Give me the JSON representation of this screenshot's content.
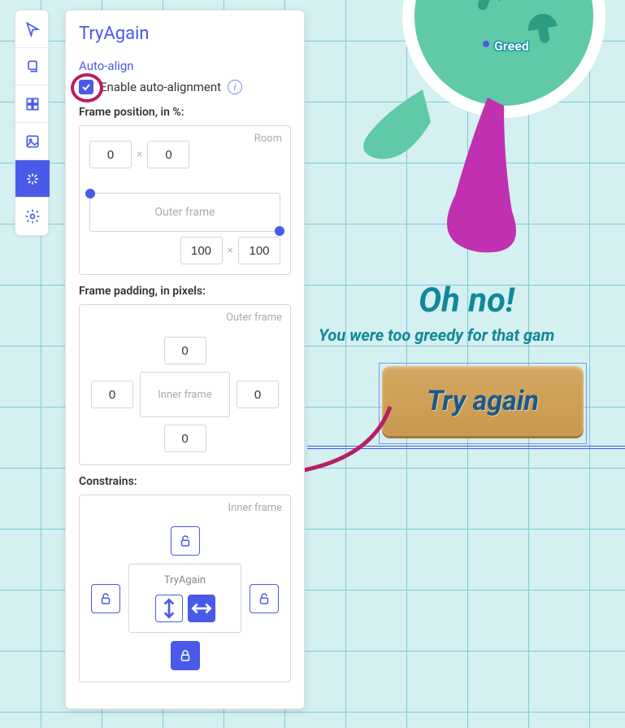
{
  "panel": {
    "title": "TryAgain",
    "auto_align_section": "Auto-align",
    "enable_label": "Enable auto-alignment",
    "frame_position_label": "Frame position, in %:",
    "frame_position": {
      "room_label": "Room",
      "outer_frame_label": "Outer frame",
      "x1": "0",
      "y1": "0",
      "x2": "100",
      "y2": "100"
    },
    "frame_padding_label": "Frame padding, in pixels:",
    "frame_padding": {
      "outer_frame_label": "Outer frame",
      "inner_frame_label": "Inner frame",
      "top": "0",
      "left": "0",
      "right": "0",
      "bottom": "0"
    },
    "constrains_label": "Constrains:",
    "constrains": {
      "inner_frame_label": "Inner frame",
      "center_label": "TryAgain",
      "locks": {
        "top": false,
        "left": false,
        "right": false,
        "bottom": true
      },
      "size_mode": "horizontal"
    }
  },
  "canvas": {
    "greed_label": "Greed",
    "ohno": "Oh no!",
    "greedy_line": "You were too greedy for that gam",
    "try_again": "Try again"
  },
  "colors": {
    "accent": "#4a5ae8",
    "annotation": "#b91e63",
    "teal": "#118899"
  }
}
